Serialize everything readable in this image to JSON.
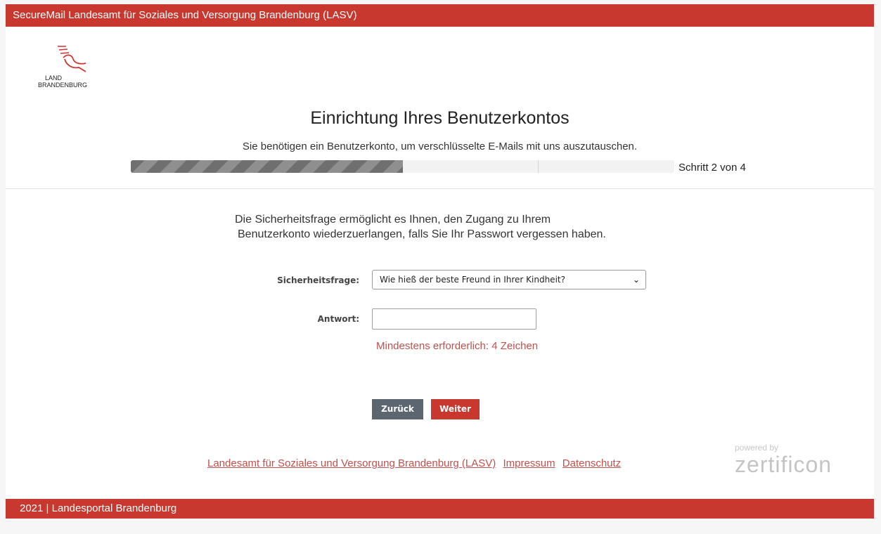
{
  "header": {
    "title": "SecureMail Landesamt für Soziales und Versorgung Brandenburg (LASV)"
  },
  "logo": {
    "line1": "LAND",
    "line2": "BRANDENBURG"
  },
  "main": {
    "title": "Einrichtung Ihres Benutzerkontos",
    "subtitle": "Sie benötigen ein Benutzerkonto, um verschlüsselte E-Mails mit uns auszutauschen.",
    "progress": {
      "step_text": "Schritt 2 von 4",
      "fraction": 0.5
    },
    "intro_line1": "Die Sicherheitsfrage ermöglicht es Ihnen, den Zugang zu Ihrem",
    "intro_line2": "Benutzerkonto wiederzuerlangen, falls Sie Ihr Passwort vergessen haben.",
    "form": {
      "question_label": "Sicherheitsfrage:",
      "question_value": "Wie hieß der beste Freund in Ihrer Kindheit?",
      "answer_label": "Antwort:",
      "answer_value": "",
      "hint": "Mindestens erforderlich: 4 Zeichen"
    },
    "buttons": {
      "back": "Zurück",
      "next": "Weiter"
    }
  },
  "footer": {
    "links": [
      "Landesamt für Soziales und Versorgung Brandenburg (LASV)",
      "Impressum",
      "Datenschutz"
    ],
    "powered_small": "powered by",
    "powered_brand": "zertificon",
    "bottom_text": "2021 | Landesportal Brandenburg"
  },
  "colors": {
    "brand_red": "#c8382f",
    "hint_red": "#c0504d",
    "back_button": "#5b6670"
  }
}
